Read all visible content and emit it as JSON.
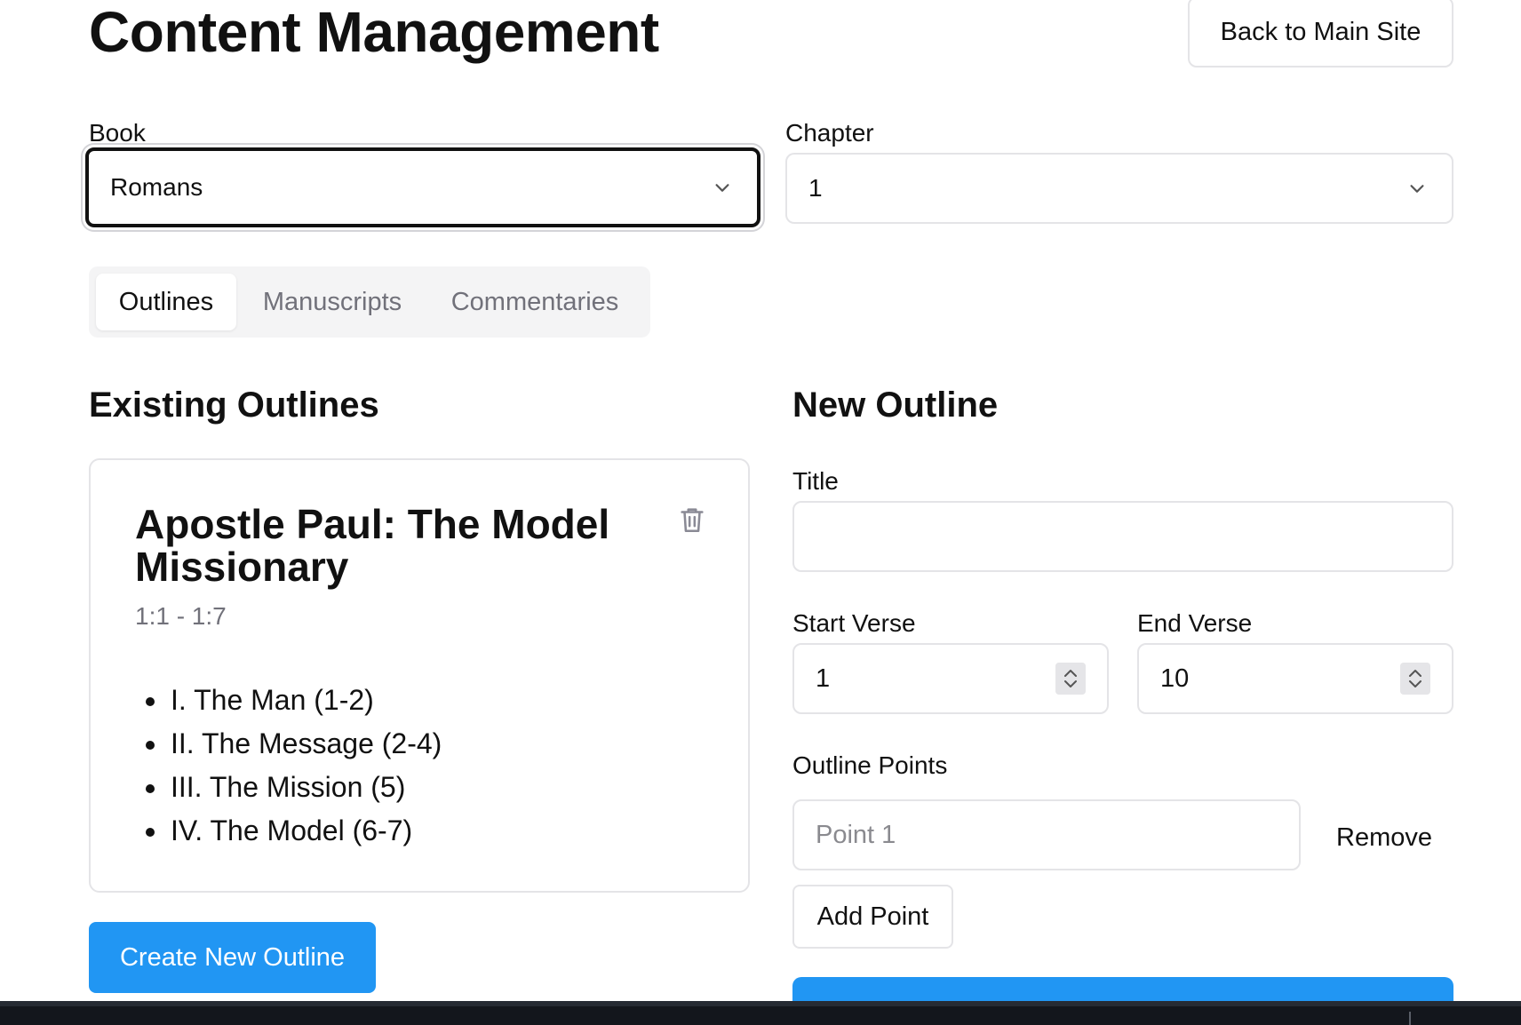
{
  "header": {
    "title": "Content Management",
    "back_button": "Back to Main Site"
  },
  "filters": {
    "book_label": "Book",
    "book_value": "Romans",
    "chapter_label": "Chapter",
    "chapter_value": "1"
  },
  "tabs": [
    {
      "label": "Outlines",
      "active": true
    },
    {
      "label": "Manuscripts",
      "active": false
    },
    {
      "label": "Commentaries",
      "active": false
    }
  ],
  "existing": {
    "heading": "Existing Outlines",
    "outlines": [
      {
        "title": "Apostle Paul: The Model Missionary",
        "range": "1:1 - 1:7",
        "points": [
          "I. The Man (1-2)",
          "II. The Message (2-4)",
          "III. The Mission (5)",
          "IV. The Model (6-7)"
        ]
      }
    ],
    "create_button": "Create New Outline"
  },
  "new_outline": {
    "heading": "New Outline",
    "title_label": "Title",
    "title_value": "",
    "start_label": "Start Verse",
    "start_value": "1",
    "end_label": "End Verse",
    "end_value": "10",
    "points_label": "Outline Points",
    "point_placeholder": "Point 1",
    "remove_button": "Remove",
    "add_point_button": "Add Point"
  },
  "colors": {
    "primary": "#2196f3",
    "border": "#e4e4e7",
    "muted_text": "#71717a",
    "tab_bg": "#f4f4f5"
  },
  "icons": {
    "select_chevron": "chevron-down-icon",
    "delete": "trash-icon",
    "number_spinner": "spinner-icon"
  }
}
